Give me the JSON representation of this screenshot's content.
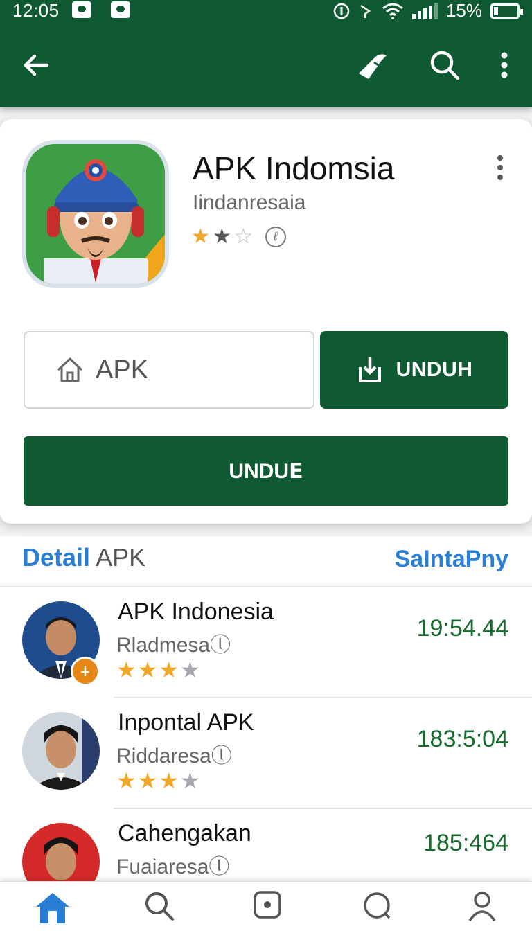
{
  "status_bar": {
    "time": "12:05",
    "battery": "15%"
  },
  "toolbar": {
    "back_icon": "arrow-left-icon",
    "share_icon": "share-icon",
    "search_icon": "search-icon",
    "more_icon": "more-vert-icon"
  },
  "app": {
    "title": "APK Indomsia",
    "developer": "Iindanresaia",
    "rating_stars": 2,
    "rating_max": 3,
    "apk_label": "APK",
    "unduh_label": "UNDUH",
    "big_button_label": "UNDUꓰ"
  },
  "detail": {
    "title_blue": "Detail",
    "title_gray": "APK",
    "link": "SaIntaPny"
  },
  "list": [
    {
      "title": "APK Indonesia",
      "subtitle": "Rladmesaⓛ",
      "stars": 3,
      "max_stars": 4,
      "time": "19:54.44",
      "badge": "∔"
    },
    {
      "title": "Inpontal APK",
      "subtitle": "Riddaresaⓛ",
      "stars": 3,
      "max_stars": 4,
      "time": "183:5:04"
    },
    {
      "title": "Cahengakan",
      "subtitle": "Fuaiaresaⓛ",
      "time": "185:464"
    }
  ],
  "bottom_nav": [
    "home-icon",
    "search-icon",
    "apps-icon",
    "chat-icon",
    "profile-icon"
  ],
  "colors": {
    "primary": "#0f5a32",
    "accent_blue": "#2a7fd4",
    "star": "#f0a82a"
  }
}
